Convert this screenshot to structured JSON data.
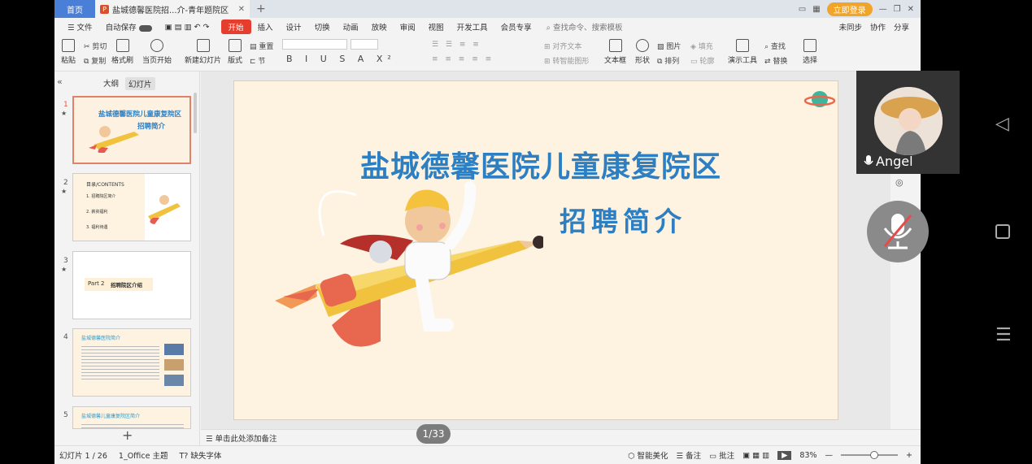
{
  "titlebar": {
    "home_tab": "首页",
    "doc_tab": "盐城德馨医院招...介-青年题院区",
    "doc_badge": "P",
    "new_tab": "+",
    "login": "立即登录"
  },
  "menu": {
    "file": "文件",
    "autosave": "自动保存",
    "items": [
      "开始",
      "插入",
      "设计",
      "切换",
      "动画",
      "放映",
      "审阅",
      "视图",
      "开发工具",
      "会员专享"
    ],
    "search": "查找命令、搜索模板",
    "right": [
      "未同步",
      "协作",
      "分享"
    ]
  },
  "ribbon": {
    "paste": "粘贴",
    "cut": "剪切",
    "copy": "复制",
    "format_painter": "格式刷",
    "from_current": "当页开始",
    "new_slide": "新建幻灯片",
    "layout": "版式",
    "reset": "重置",
    "section": "节",
    "align_text": "对齐文本",
    "smart_shape": "转智能图形",
    "textbox": "文本框",
    "shape": "形状",
    "picture": "图片",
    "arrange": "排列",
    "fill": "填充",
    "outline": "轮廓",
    "present_tools": "演示工具",
    "find": "查找",
    "replace": "替换",
    "select": "选择"
  },
  "panel": {
    "tab_outline": "大纲",
    "tab_slides": "幻灯片",
    "slide_numbers": [
      "1",
      "2",
      "3",
      "4",
      "5"
    ],
    "thumb1": {
      "title": "盐城德馨医院儿童康复院区",
      "sub": "招聘简介"
    },
    "thumb2": {
      "heading": "目录/CONTENTS",
      "items": [
        "1. 招聘院区简介",
        "2. 薪资福利",
        "3. 福利待遇"
      ]
    },
    "thumb3": {
      "part": "Part 2",
      "title": "招聘院区介绍"
    },
    "thumb4": {
      "heading": "盐城德馨医院简介"
    },
    "thumb5": {
      "heading": "盐城德馨儿童康复院区简介"
    }
  },
  "slide": {
    "title": "盐城德馨医院儿童康复院区",
    "subtitle": "招聘简介"
  },
  "notes_placeholder": "单击此处添加备注",
  "page_indicator": "1/33",
  "status": {
    "slide_count": "幻灯片 1 / 26",
    "theme": "1_Office 主题",
    "missing_font": "缺失字体",
    "beautify": "智能美化",
    "notes": "备注",
    "comments": "批注",
    "zoom": "83%"
  },
  "video": {
    "name": "Angel"
  },
  "colors": {
    "accent_red": "#e63e2e",
    "title_blue": "#2d7fc4",
    "home_blue": "#4a7fd8",
    "slide_bg": "#fdf3e0"
  }
}
